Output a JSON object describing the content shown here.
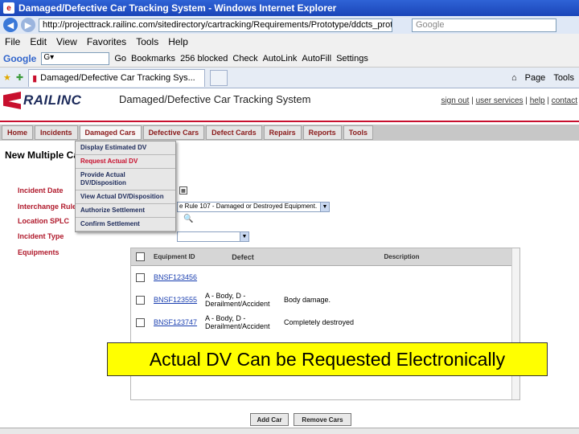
{
  "browser": {
    "window_title": "Damaged/Defective Car Tracking System - Windows Internet Explorer",
    "address": "http://projecttrack.railinc.com/sitedirectory/cartracking/Requirements/Prototype/ddcts_proto",
    "search_placeholder": "Google",
    "menu": [
      "File",
      "Edit",
      "View",
      "Favorites",
      "Tools",
      "Help"
    ],
    "google_toolbar": {
      "logo": "Google",
      "go": "Go",
      "items": [
        "Bookmarks",
        "256 blocked",
        "Check",
        "AutoLink",
        "AutoFill",
        "Settings"
      ]
    },
    "tab_title": "Damaged/Defective Car Tracking Sys...",
    "tab_right": [
      "Page",
      "Tools"
    ]
  },
  "header": {
    "logo_text": "RAILINC",
    "app_title": "Damaged/Defective Car Tracking System",
    "links": [
      "sign out",
      "user services",
      "help",
      "contact"
    ]
  },
  "nav": [
    "Home",
    "Incidents",
    "Damaged Cars",
    "Defective Cars",
    "Defect Cards",
    "Repairs",
    "Reports",
    "Tools"
  ],
  "dropdown": [
    "Display Estimated DV",
    "Request Actual DV",
    "Provide Actual DV/Disposition",
    "View Actual DV/Disposition",
    "Authorize Settlement",
    "Confirm Settlement"
  ],
  "page_title": "New Multiple Ca",
  "form": {
    "labels": [
      "Incident Date",
      "Interchange Rule",
      "Location SPLC",
      "Incident Type",
      "Equipments"
    ],
    "interchange_value": "e Rule 107 - Damaged or Destroyed Equipment."
  },
  "table": {
    "headers": [
      "Equipment ID",
      "Defect",
      "Description"
    ],
    "rows": [
      {
        "id": "BNSF123456",
        "defect": "",
        "description": ""
      },
      {
        "id": "BNSF123555",
        "defect": "A - Body, D - Derailment/Accident",
        "description": "Body damage."
      },
      {
        "id": "BNSF123747",
        "defect": "A - Body, D - Derailment/Accident",
        "description": "Completely destroyed"
      }
    ]
  },
  "banner": "Actual DV Can be Requested Electronically",
  "buttons": {
    "add": "Add Car",
    "remove": "Remove Cars"
  }
}
